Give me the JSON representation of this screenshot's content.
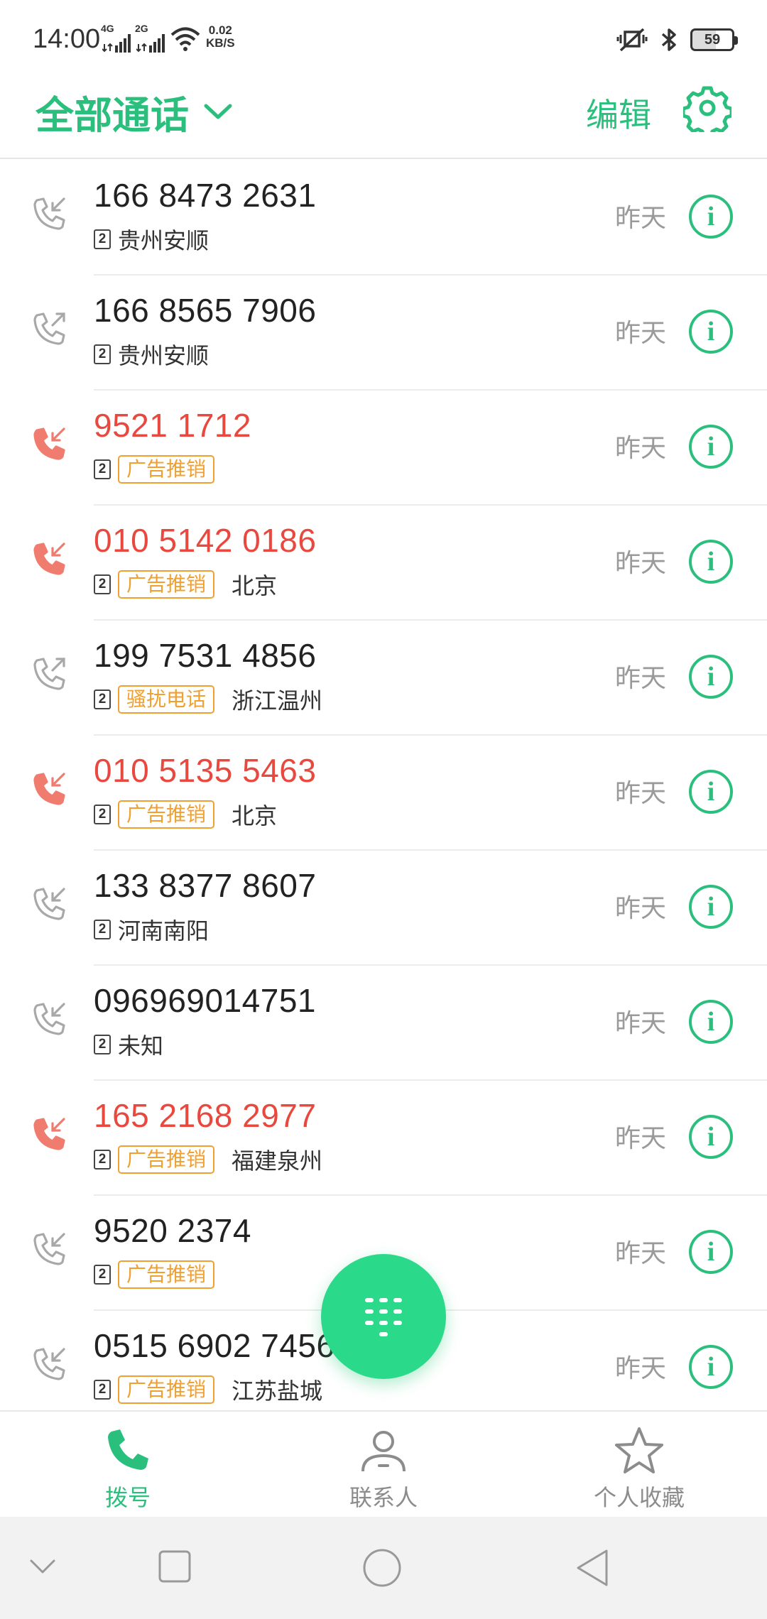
{
  "status_bar": {
    "time": "14:00",
    "sim1_label": "4G",
    "sim2_label": "2G",
    "speed_value": "0.02",
    "speed_unit": "KB/S",
    "battery": "59"
  },
  "header": {
    "title": "全部通话",
    "edit_label": "编辑"
  },
  "calls": [
    {
      "number": "166 8473 2631",
      "sim": "2",
      "tag": "",
      "location": "贵州安顺",
      "date": "昨天",
      "type": "incoming"
    },
    {
      "number": "166 8565 7906",
      "sim": "2",
      "tag": "",
      "location": "贵州安顺",
      "date": "昨天",
      "type": "outgoing"
    },
    {
      "number": "9521 1712",
      "sim": "2",
      "tag": "广告推销",
      "location": "",
      "date": "昨天",
      "type": "missed"
    },
    {
      "number": "010 5142 0186",
      "sim": "2",
      "tag": "广告推销",
      "location": "北京",
      "date": "昨天",
      "type": "missed"
    },
    {
      "number": "199 7531 4856",
      "sim": "2",
      "tag": "骚扰电话",
      "location": "浙江温州",
      "date": "昨天",
      "type": "outgoing"
    },
    {
      "number": "010 5135 5463",
      "sim": "2",
      "tag": "广告推销",
      "location": "北京",
      "date": "昨天",
      "type": "missed"
    },
    {
      "number": "133 8377 8607",
      "sim": "2",
      "tag": "",
      "location": "河南南阳",
      "date": "昨天",
      "type": "incoming"
    },
    {
      "number": "096969014751",
      "sim": "2",
      "tag": "",
      "location": "未知",
      "date": "昨天",
      "type": "incoming"
    },
    {
      "number": "165 2168 2977",
      "sim": "2",
      "tag": "广告推销",
      "location": "福建泉州",
      "date": "昨天",
      "type": "missed"
    },
    {
      "number": "9520 2374",
      "sim": "2",
      "tag": "广告推销",
      "location": "",
      "date": "昨天",
      "type": "incoming"
    },
    {
      "number": "0515 6902 7456",
      "sim": "2",
      "tag": "广告推销",
      "location": "江苏盐城",
      "date": "昨天",
      "type": "incoming"
    }
  ],
  "bottom_nav": [
    {
      "label": "拨号",
      "icon": "phone-icon",
      "active": true
    },
    {
      "label": "联系人",
      "icon": "person-icon",
      "active": false
    },
    {
      "label": "个人收藏",
      "icon": "star-icon",
      "active": false
    }
  ],
  "colors": {
    "accent": "#2bbf7e",
    "missed": "#e8483e",
    "tag": "#f0a030",
    "secondary_text": "#9a9a9a"
  }
}
